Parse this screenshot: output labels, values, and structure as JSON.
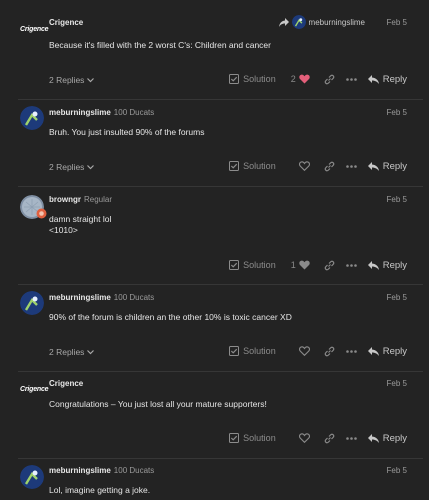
{
  "posts": [
    {
      "author": "Crigence",
      "title": "",
      "logo": "Crigence",
      "date": "Feb 5",
      "reply_to": "meburningslime",
      "body": "Because it's filled with the 2 worst C's: Children and cancer",
      "replies": "2 Replies",
      "solution": "Solution",
      "likes": "2",
      "liked": true,
      "reply": "Reply"
    },
    {
      "author": "meburningslime",
      "title": "100 Ducats",
      "date": "Feb 5",
      "body": "Bruh. You just insulted 90% of the forums",
      "replies": "2 Replies",
      "solution": "Solution",
      "likes": "",
      "reply": "Reply"
    },
    {
      "author": "browngr",
      "title": "Regular",
      "date": "Feb 5",
      "body": "damn straight lol\n<1010>",
      "replies": "",
      "solution": "Solution",
      "likes": "1",
      "reply": "Reply"
    },
    {
      "author": "meburningslime",
      "title": "100 Ducats",
      "date": "Feb 5",
      "body": "90% of the forum is children an the other 10% is toxic cancer XD",
      "replies": "2 Replies",
      "solution": "Solution",
      "likes": "",
      "reply": "Reply"
    },
    {
      "author": "Crigence",
      "title": "",
      "logo": "Crigence",
      "date": "Feb 5",
      "body": "Congratulations – You just lost all your mature supporters!",
      "replies": "",
      "solution": "Solution",
      "likes": "",
      "reply": "Reply"
    },
    {
      "author": "meburningslime",
      "title": "100 Ducats",
      "date": "Feb 5",
      "body": "Lol, imagine getting a joke.",
      "replies": "",
      "solution": "",
      "likes": "",
      "reply": ""
    }
  ],
  "colors": {
    "background": "#232323",
    "heart_active": "#e45f7a",
    "divider": "#363636"
  },
  "icons": [
    "check-square-icon",
    "heart-icon",
    "link-icon",
    "more-icon",
    "reply-icon",
    "chevron-down-icon",
    "share-arrow-icon"
  ]
}
